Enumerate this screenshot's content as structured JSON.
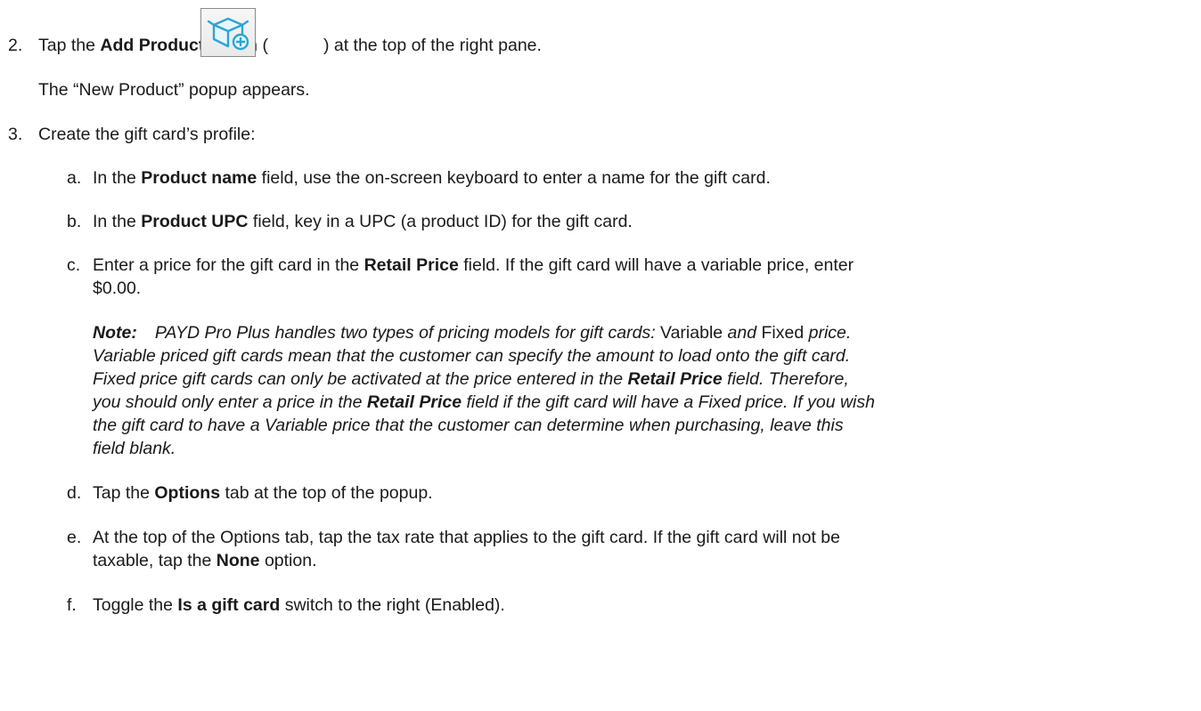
{
  "step2": {
    "number": "2.",
    "before": "Tap the ",
    "button_name": "Add Product",
    "after_bold": " button (",
    "after_icon": ") at the top of the right pane.",
    "icon": "add-product-box-icon",
    "result": "The “New Product” popup appears."
  },
  "step3": {
    "number": "3.",
    "text": "Create the gift card’s profile:"
  },
  "substeps": {
    "a": {
      "letter": "a.",
      "before": "In the ",
      "bold": "Product name",
      "after": " field, use the on-screen keyboard to enter a name for the gift card."
    },
    "b": {
      "letter": "b.",
      "before": "In the ",
      "bold": "Product UPC",
      "after": " field, key in a UPC (a product ID) for the gift card."
    },
    "c": {
      "letter": "c.",
      "before": "Enter a price for the gift card in the ",
      "bold": "Retail Price",
      "after": " field. If the gift card will have a variable price, enter",
      "line2": "$0.00."
    },
    "note": {
      "label": "Note:",
      "l1_a": "PAYD Pro Plus handles two types of pricing models for gift cards: ",
      "l1_b": "Variable",
      "l1_c": " and ",
      "l1_d": "Fixed",
      "l1_e": " price.",
      "l2": "Variable priced gift cards mean that the customer can specify the amount to load onto the gift card.",
      "l3_a": "Fixed price gift cards can only be activated at the price entered in the ",
      "l3_b": "Retail Price",
      "l3_c": " field. Therefore,",
      "l4_a": "you should only enter a price in the ",
      "l4_b": "Retail Price",
      "l4_c": " field if the gift card will have a Fixed price. If you wish",
      "l5": "the gift card to have a Variable price that the customer can determine when purchasing, leave this",
      "l6": "field blank."
    },
    "d": {
      "letter": "d.",
      "before": "Tap the ",
      "bold": "Options",
      "after": " tab at the top of the popup."
    },
    "e": {
      "letter": "e.",
      "line1": "At the top of the Options tab, tap the tax rate that applies to the gift card. If the gift card will not be",
      "before2": "taxable, tap the ",
      "bold": "None",
      "after2": " option."
    },
    "f": {
      "letter": "f.",
      "before": "Toggle the ",
      "bold": "Is a gift card",
      "after": " switch to the right (Enabled)."
    }
  }
}
